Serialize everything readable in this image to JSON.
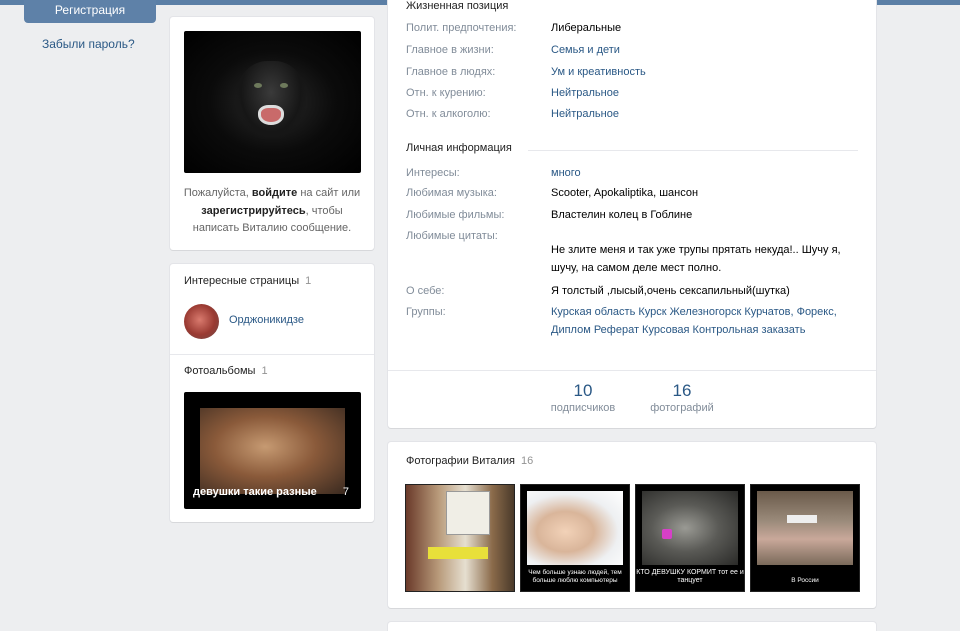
{
  "sidebar_left": {
    "register_label": "Регистрация",
    "forgot_label": "Забыли пароль?"
  },
  "profile": {
    "avatar_icon": "panther-photo",
    "login_prompt": {
      "part1": "Пожалуйста, ",
      "login_link": "войдите",
      "part2": " на сайт или",
      "register_link": "зарегистрируйтесь",
      "part3": ", чтобы написать Виталию сообщение."
    }
  },
  "interesting_pages": {
    "title": "Интересные страницы",
    "count": "1",
    "items": [
      {
        "name": "Орджоникидзе"
      }
    ]
  },
  "albums": {
    "title": "Фотоальбомы",
    "count": "1",
    "items": [
      {
        "title": "девушки такие разные",
        "count": "7"
      }
    ]
  },
  "life_position": {
    "title": "Жизненная позиция",
    "rows": [
      {
        "label": "Полит. предпочтения:",
        "value": "Либеральные",
        "is_link": false
      },
      {
        "label": "Главное в жизни:",
        "value": "Семья и дети",
        "is_link": true
      },
      {
        "label": "Главное в людях:",
        "value": "Ум и креативность",
        "is_link": true
      },
      {
        "label": "Отн. к курению:",
        "value": "Нейтральное",
        "is_link": true
      },
      {
        "label": "Отн. к алкоголю:",
        "value": "Нейтральное",
        "is_link": true
      }
    ]
  },
  "personal_info": {
    "title": "Личная информация",
    "rows": [
      {
        "label": "Интересы:",
        "value": "много",
        "is_link": true
      },
      {
        "label": "Любимая музыка:",
        "value": "Scooter, Apokaliptika, шансон",
        "is_link": false
      },
      {
        "label": "Любимые фильмы:",
        "value": "Властелин колец в Гоблине",
        "is_link": false
      },
      {
        "label": "Любимые цитаты:",
        "value": "Не злите меня и так уже трупы прятать некуда!.. Шучу я, шучу, на самом деле мест полно.",
        "is_link": false
      },
      {
        "label": "О себе:",
        "value": "Я толстый ,лысый,очень сексапильный(шутка)",
        "is_link": false
      },
      {
        "label": "Группы:",
        "value": "Курская область Курск Железногорск Курчатов, Форекс, Диплом Реферат Курсовая Контрольная заказать",
        "is_link": true
      }
    ]
  },
  "counters": [
    {
      "number": "10",
      "label": "подписчиков"
    },
    {
      "number": "16",
      "label": "фотографий"
    }
  ],
  "photos": {
    "title": "Фотографии Виталия",
    "count": "16",
    "items": [
      {
        "caption": ""
      },
      {
        "caption": "Чем больше узнаю людей, тем больше люблю компьютеры"
      },
      {
        "caption": "КТО ДЕВУШКУ КОРМИТ тот ее и танцует"
      },
      {
        "caption": "В России"
      }
    ]
  },
  "colors": {
    "link": "#2a5885",
    "label": "#818c99",
    "background": "#edeef0",
    "header": "#5e81a8"
  }
}
